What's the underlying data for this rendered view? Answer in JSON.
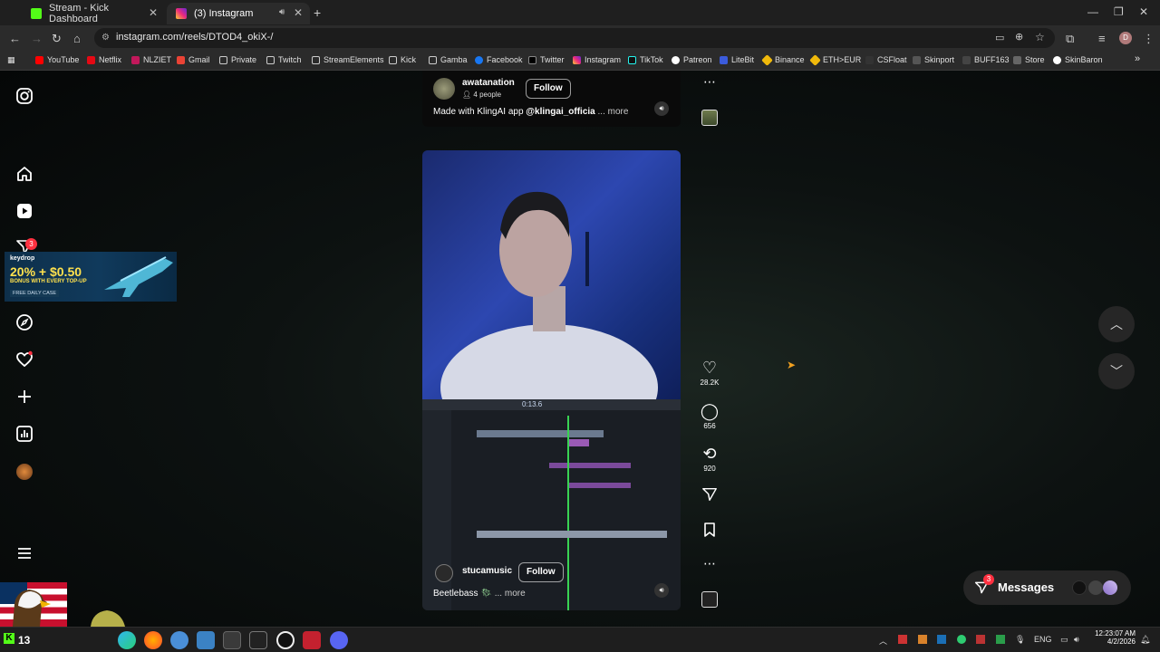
{
  "browser": {
    "tabs": [
      {
        "title": "Stream - Kick Dashboard",
        "active": false
      },
      {
        "title": "(3) Instagram",
        "active": true
      }
    ],
    "new_tab_icon": "plus-icon",
    "url": "instagram.com/reels/DTOD4_okiX-/",
    "profile_initial": "D",
    "bookmarks": [
      "YouTube",
      "Netflix",
      "NLZIET",
      "Gmail",
      "Private",
      "Twitch",
      "StreamElements",
      "Kick",
      "Gamba",
      "Facebook",
      "Twitter",
      "Instagram",
      "TikTok",
      "Patreon",
      "LiteBit",
      "Binance",
      "ETH>EUR",
      "CSFloat",
      "Skinport",
      "BUFF163",
      "Store",
      "SkinBaron"
    ]
  },
  "sidebar": {
    "notification_count": "3",
    "ad": {
      "brand": "keydrop",
      "headline": "20% + $0.50",
      "subline": "BONUS WITH EVERY TOP-UP",
      "footer": "FREE DAILY CASE"
    }
  },
  "reel_top": {
    "username": "awatanation",
    "people": "4 people",
    "follow": "Follow",
    "caption": "Made with KlingAI app",
    "mention": "@klingai_officia",
    "more": "... more"
  },
  "reel_main": {
    "username": "stucamusic",
    "follow": "Follow",
    "caption": "Beetlebass",
    "more": "... more",
    "timer": "0:13.6"
  },
  "actions": {
    "likes": "28.2K",
    "comments": "656",
    "reposts": "920"
  },
  "messages": {
    "label": "Messages",
    "badge": "3"
  },
  "overlay": {
    "viewer_count": "13"
  },
  "taskbar": {
    "language": "ENG",
    "time": "12:23:07 AM",
    "date": "4/2/2026"
  },
  "colors": {
    "accent_red": "#ff3040",
    "browser_bg": "#2b2b2b",
    "kick_green": "#53fc18"
  }
}
